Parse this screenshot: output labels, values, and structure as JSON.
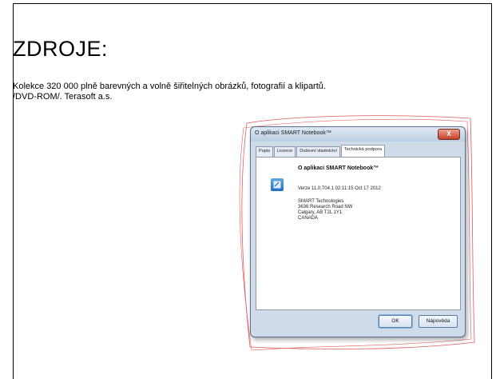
{
  "slide": {
    "title": "ZDROJE:",
    "text_line1": "Kolekce 320 000 plně barevných a volně šiřitelných obrázků, fotografií a klipartů.",
    "text_line2": "/DVD-ROM/. Terasoft a.s."
  },
  "dialog": {
    "window_title": "O aplikaci SMART Notebook™",
    "close_label": "X",
    "tabs": [
      {
        "label": "Popis"
      },
      {
        "label": "Licence"
      },
      {
        "label": "Duševní vlastnictví"
      },
      {
        "label": "Technická podpora",
        "active": true
      }
    ],
    "heading": "O aplikaci SMART Notebook™",
    "version": "Verze 11.0.704.1 02:11:15 Oct 17 2012",
    "address": [
      "SMART Technologies",
      "3636 Research Road NW",
      "Calgary, AB T2L 1Y1",
      "CANADA"
    ],
    "ok_label": "OK",
    "help_label": "Nápověda"
  },
  "colors": {
    "outline_red": "#e05a5a",
    "dialog_frame": "#cfdbe9"
  }
}
